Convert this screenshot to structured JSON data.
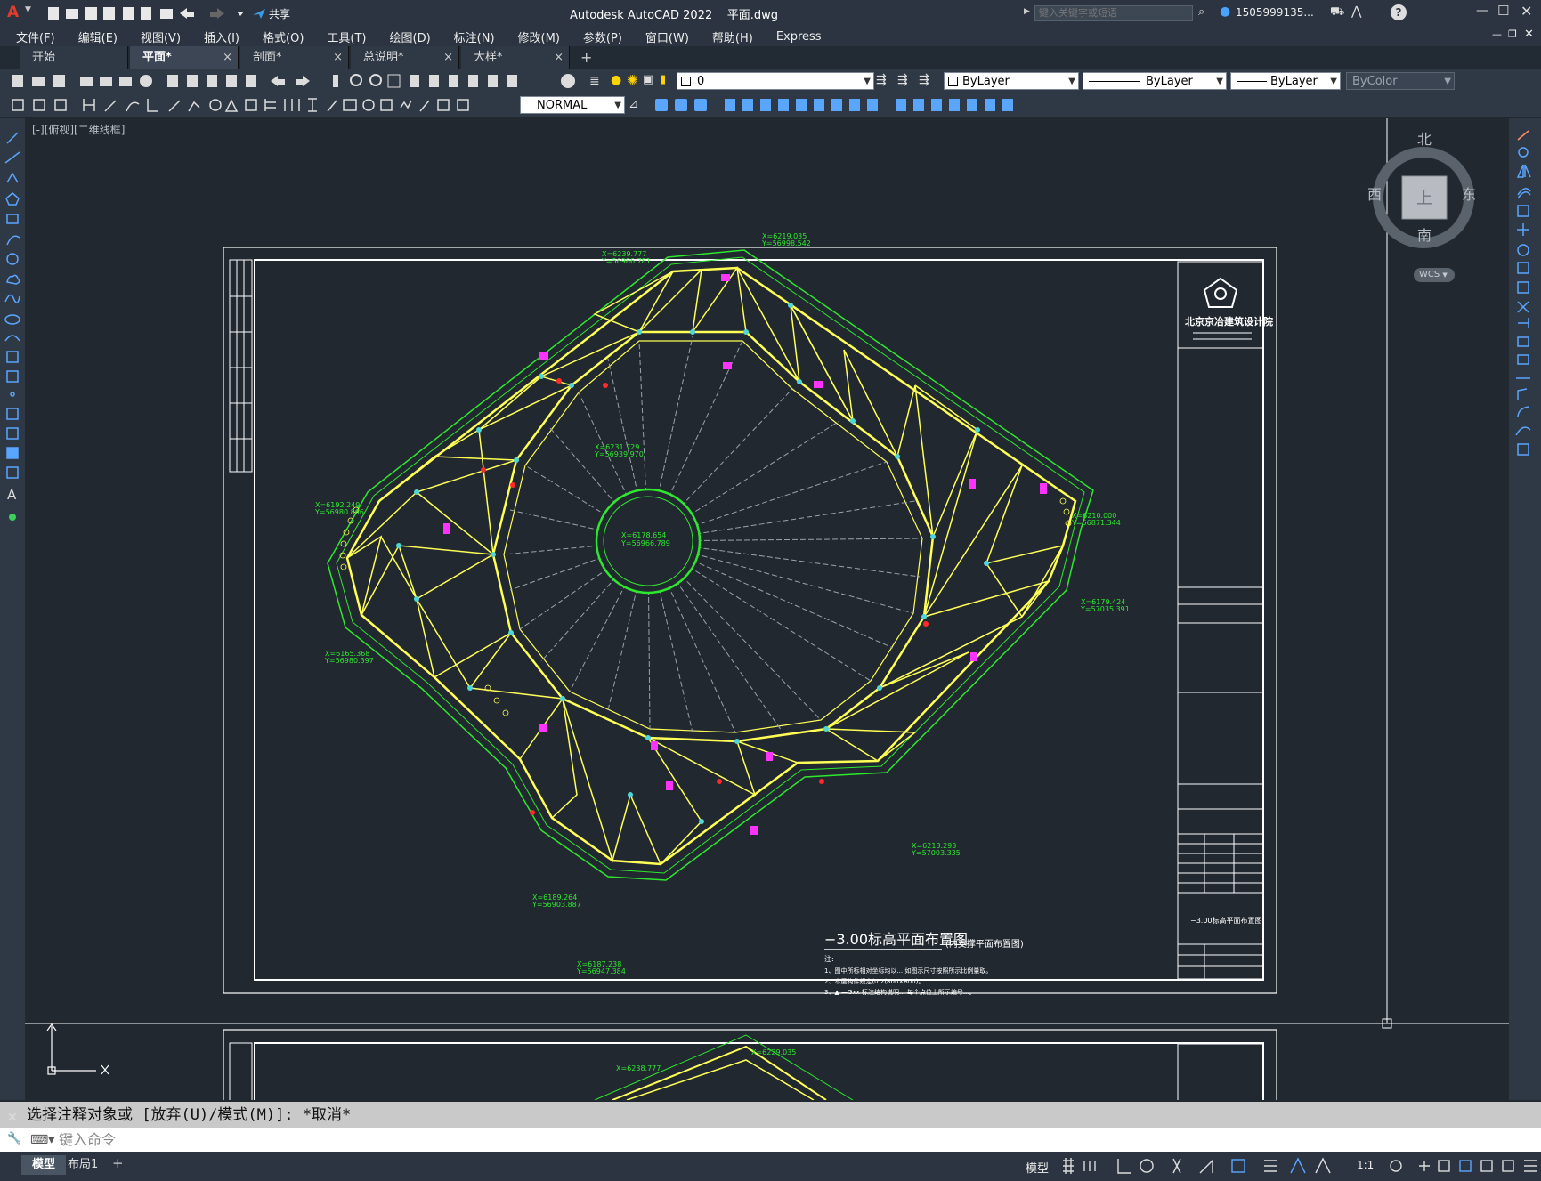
{
  "titlebar": {
    "share_label": "共享",
    "title": "Autodesk AutoCAD 2022    平面.dwg",
    "search_placeholder": "键入关键字或短语",
    "user": "1505999135...",
    "help": "?"
  },
  "menu": [
    "文件(F)",
    "编辑(E)",
    "视图(V)",
    "插入(I)",
    "格式(O)",
    "工具(T)",
    "绘图(D)",
    "标注(N)",
    "修改(M)",
    "参数(P)",
    "窗口(W)",
    "帮助(H)",
    "Express"
  ],
  "tabs": [
    {
      "label": "开始",
      "close": ""
    },
    {
      "label": "平面*",
      "close": "×"
    },
    {
      "label": "剖面*",
      "close": "×"
    },
    {
      "label": "总说明*",
      "close": "×"
    },
    {
      "label": "大样*",
      "close": "×"
    }
  ],
  "tab_add": "+",
  "layer": {
    "current": "0"
  },
  "properties": {
    "color": "ByLayer",
    "linetype": "ByLayer",
    "lineweight": "ByLayer",
    "plotstyle": "ByColor"
  },
  "dimstyle": {
    "current": "NORMAL"
  },
  "viewport": {
    "label": "[-][俯视][二维线框]",
    "viewcube": {
      "north": "北",
      "south": "南",
      "east": "东",
      "west": "西",
      "face": "上",
      "wcs": "WCS"
    }
  },
  "drawing": {
    "title": "−3.00标高平面布置图",
    "subtitle": "(内支撑平面布置图)",
    "notes_heading": "注:",
    "notes": [
      "1、图中所标相对坐标均以... 如图示尺寸按照所示比例量取。",
      "2、本层构件规定(0.2(800×800)。",
      "3、▲ —Gxx 标注结构说明... 每个点位上所示编号...。"
    ],
    "center_coord": [
      "X=6178.654",
      "Y=56966.789"
    ],
    "company": "北京京冶建筑设计院",
    "titleblock_label": "−3.00标高平面布置图",
    "coords": [
      [
        "X=6239.777",
        "Y=56986.781"
      ],
      [
        "X=6219.035",
        "Y=56998.542"
      ],
      [
        "X=6192.249",
        "Y=56980.866"
      ],
      [
        "X=6165.368",
        "Y=56980.397"
      ],
      [
        "X=6231.729",
        "Y=56939.970"
      ],
      [
        "X=6210.000",
        "Y=56871.344"
      ],
      [
        "X=6179.424",
        "Y=57035.391"
      ],
      [
        "X=6213.293",
        "Y=57003.335"
      ],
      [
        "X=6189.264",
        "Y=56903.887"
      ],
      [
        "X=6187.238",
        "Y=56947.384"
      ]
    ],
    "lower_coords": [
      "X=6238.777",
      "X=6229.035"
    ]
  },
  "command": {
    "output": "选择注释对象或 [放弃(U)/模式(M)]: *取消*",
    "input_placeholder": "键入命令"
  },
  "layout_tabs": [
    "模型",
    "布局1"
  ],
  "layout_add": "+",
  "status": {
    "model": "模型",
    "scale": "1:1"
  }
}
